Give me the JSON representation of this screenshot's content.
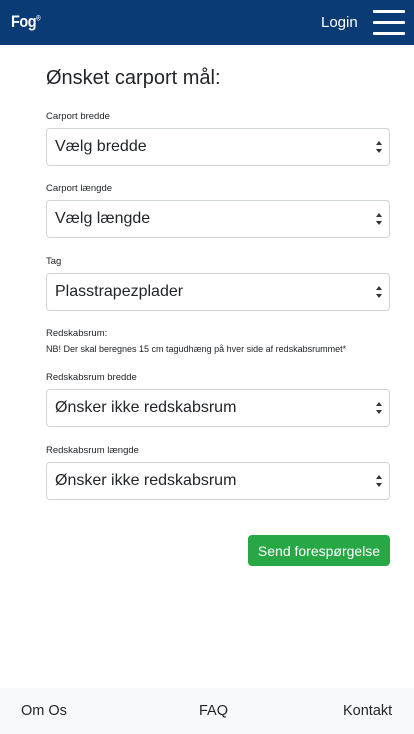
{
  "navbar": {
    "logo": "Fog",
    "logo_mark": "®",
    "login_label": "Login",
    "menu_icon": "hamburger-menu-icon",
    "bg_color": "#0b3b74"
  },
  "form": {
    "title": "Ønsket carport mål:",
    "carport_width": {
      "label": "Carport bredde",
      "value": "Vælg bredde"
    },
    "carport_length": {
      "label": "Carport længde",
      "value": "Vælg længde"
    },
    "roof": {
      "label": "Tag",
      "value": "Plasstrapezplader"
    },
    "shed_note_title": "Redskabsrum:",
    "shed_note_text": "NB! Der skal beregnes 15 cm tagudhæng på hver side af redskabsrummet*",
    "shed_width": {
      "label": "Redskabsrum bredde",
      "value": "Ønsker ikke redskabsrum"
    },
    "shed_length": {
      "label": "Redskabsrum længde",
      "value": "Ønsker ikke redskabsrum"
    },
    "submit_label": "Send forespørgelse",
    "submit_color": "#28a745"
  },
  "footer": {
    "about": "Om Os",
    "faq": "FAQ",
    "contact": "Kontakt"
  }
}
